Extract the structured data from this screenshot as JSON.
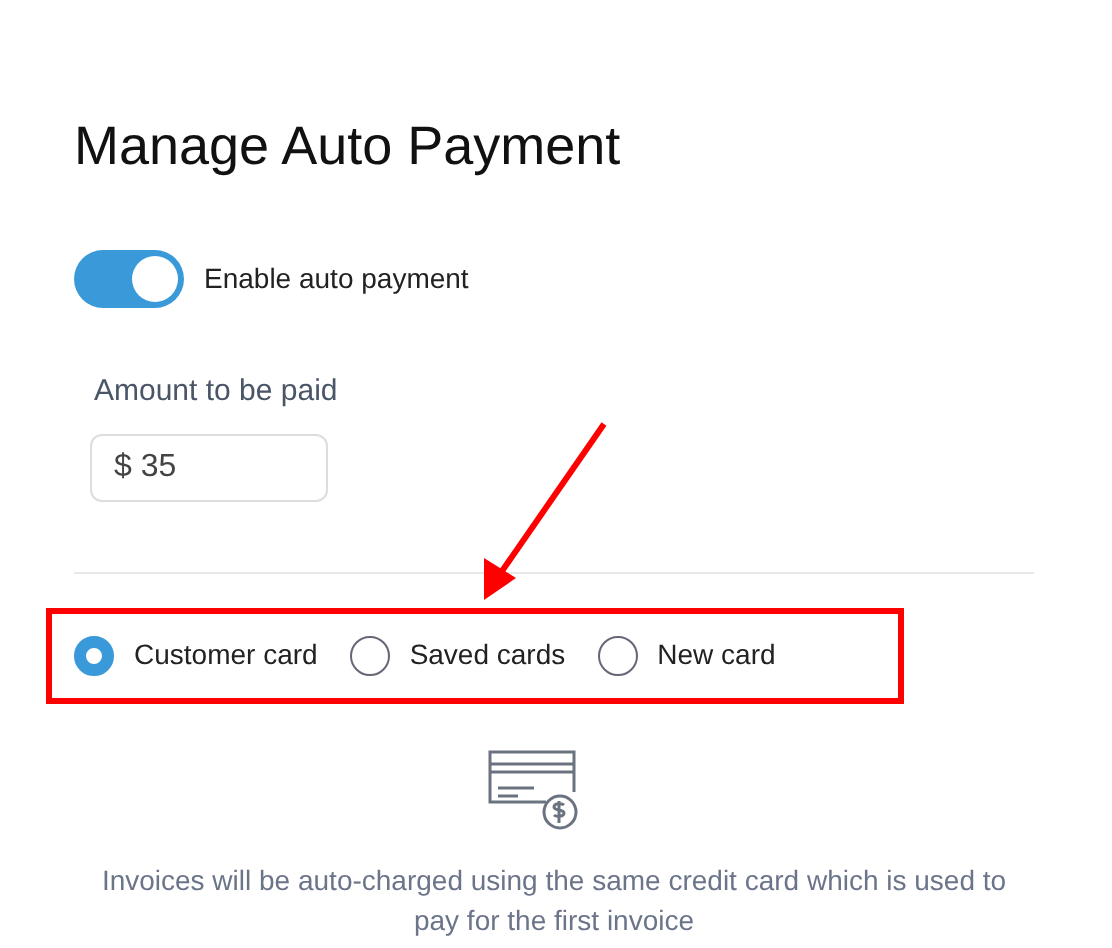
{
  "title": "Manage Auto Payment",
  "auto_payment": {
    "label": "Enable auto payment",
    "on": true
  },
  "amount": {
    "label": "Amount to be paid",
    "value": "$ 35"
  },
  "card_options": [
    {
      "label": "Customer card",
      "selected": true
    },
    {
      "label": "Saved cards",
      "selected": false
    },
    {
      "label": "New card",
      "selected": false
    }
  ],
  "note": "Invoices will be auto-charged using the same credit card which is used to pay for the first invoice"
}
